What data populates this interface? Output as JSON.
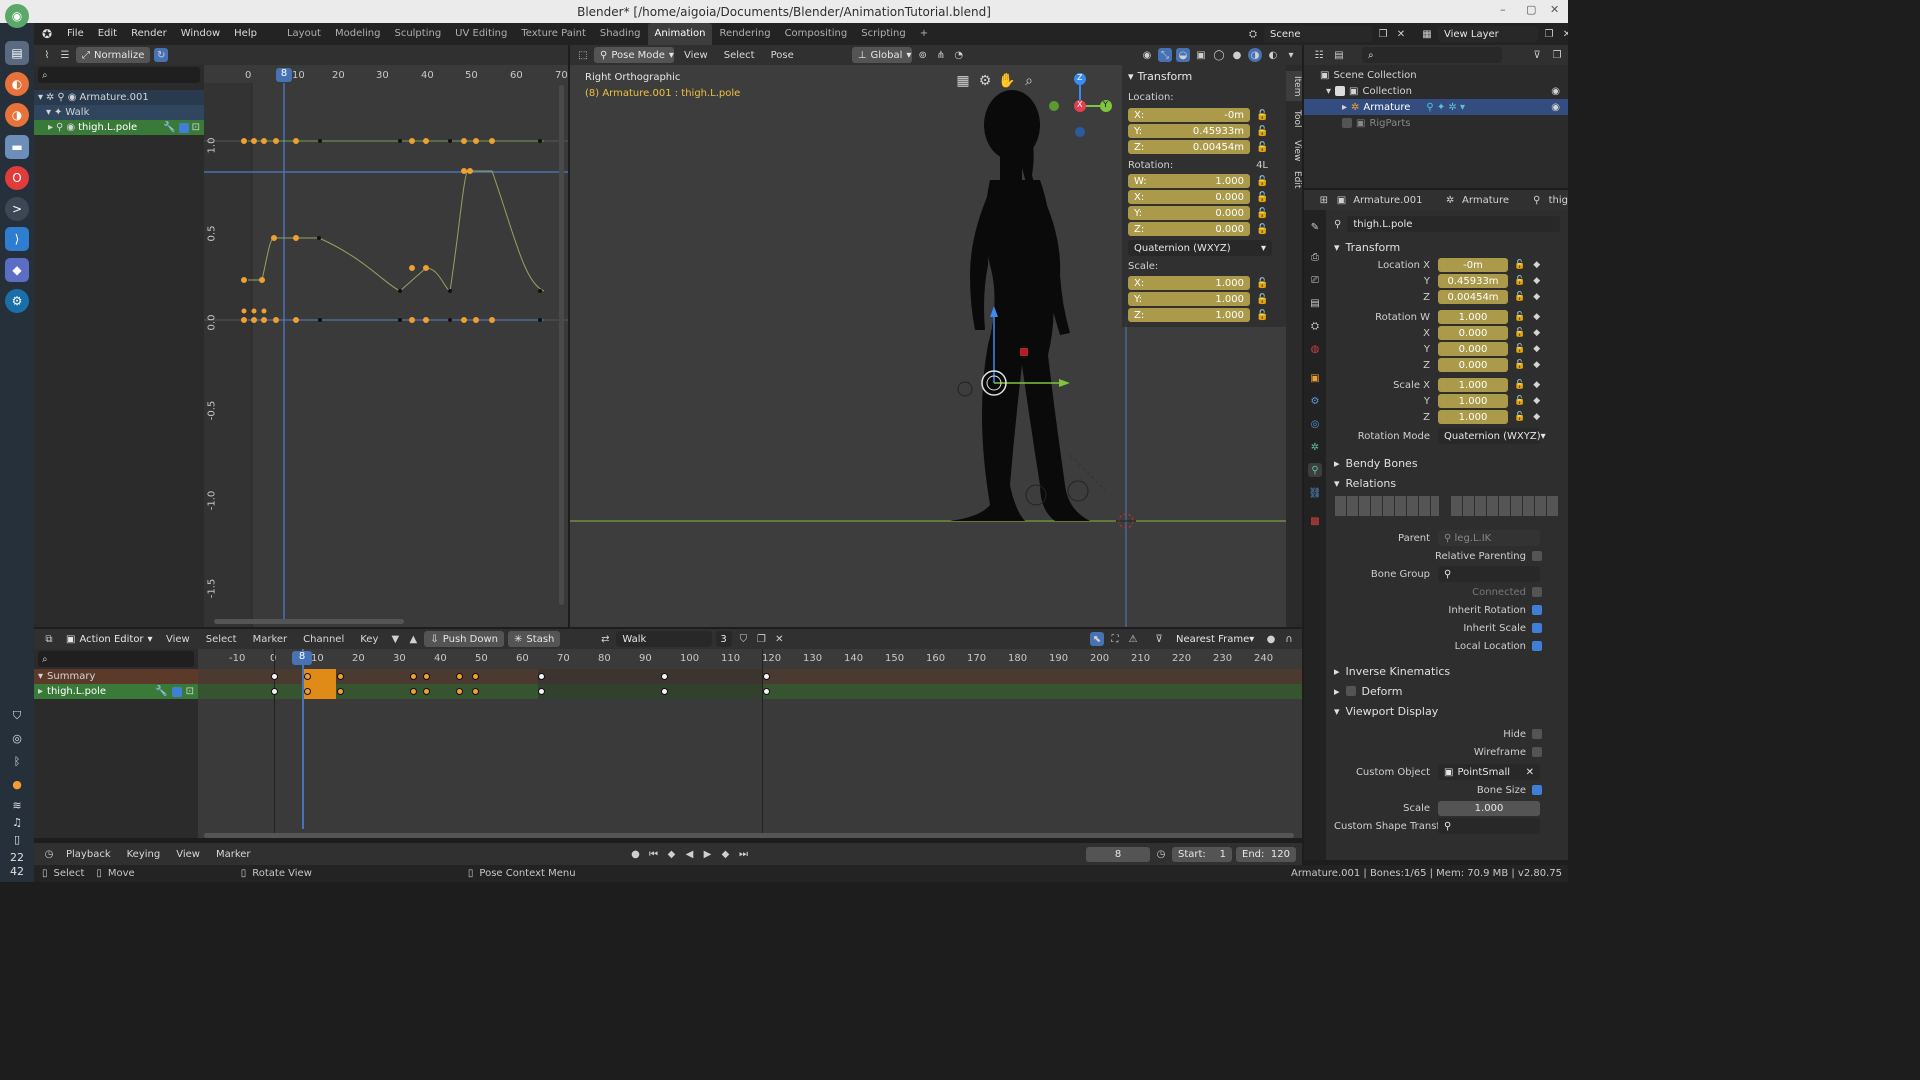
{
  "window": {
    "title": "Blender* [/home/aigoia/Documents/Blender/AnimationTutorial.blend]"
  },
  "dock": {
    "bottom_numbers": [
      "22",
      "42"
    ]
  },
  "menu": {
    "items": [
      "File",
      "Edit",
      "Render",
      "Window",
      "Help"
    ]
  },
  "workspaces": {
    "tabs": [
      "Layout",
      "Modeling",
      "Sculpting",
      "UV Editing",
      "Texture Paint",
      "Shading",
      "Animation",
      "Rendering",
      "Compositing",
      "Scripting"
    ],
    "active": "Animation",
    "add": "+"
  },
  "scene": {
    "name": "Scene",
    "view_layer": "View Layer"
  },
  "graph": {
    "normalize_label": "Normalize",
    "current_frame": "8",
    "x_ticks": [
      "0",
      "10",
      "20",
      "30",
      "40",
      "50",
      "60",
      "70"
    ],
    "y_ticks": [
      "1.0",
      "0.5",
      "0.0",
      "-0.5",
      "-1.0",
      "-1.5"
    ],
    "channels": [
      {
        "label": "Armature.001"
      },
      {
        "label": "Walk"
      },
      {
        "label": "thigh.L.pole"
      }
    ]
  },
  "viewport": {
    "mode": "Pose Mode",
    "menus": [
      "View",
      "Select",
      "Pose"
    ],
    "orientation": "Global",
    "view_name": "Right Orthographic",
    "object_info": "(8) Armature.001 : thigh.L.pole",
    "side_tabs": [
      "Item",
      "Tool",
      "View",
      "Edit"
    ],
    "gizmo": {
      "x": "X",
      "y": "Y",
      "z": "Z"
    },
    "n_panel": {
      "header": "Transform",
      "location_label": "Location:",
      "location": [
        {
          "axis": "X:",
          "value": "-0m"
        },
        {
          "axis": "Y:",
          "value": "0.45933m"
        },
        {
          "axis": "Z:",
          "value": "0.00454m"
        }
      ],
      "rotation_label": "Rotation:",
      "rotation_mode_tag": "4L",
      "rotation": [
        {
          "axis": "W:",
          "value": "1.000"
        },
        {
          "axis": "X:",
          "value": "0.000"
        },
        {
          "axis": "Y:",
          "value": "0.000"
        },
        {
          "axis": "Z:",
          "value": "0.000"
        }
      ],
      "rotation_mode": "Quaternion (WXYZ)",
      "scale_label": "Scale:",
      "scale": [
        {
          "axis": "X:",
          "value": "1.000"
        },
        {
          "axis": "Y:",
          "value": "1.000"
        },
        {
          "axis": "Z:",
          "value": "1.000"
        }
      ]
    }
  },
  "outliner": {
    "items": [
      {
        "label": "Scene Collection"
      },
      {
        "label": "Collection"
      },
      {
        "label": "Armature"
      },
      {
        "label": "RigParts"
      }
    ]
  },
  "properties": {
    "breadcrumb": [
      "Armature.001",
      "Armature",
      "thig"
    ],
    "bone_name": "thigh.L.pole",
    "transform_header": "Transform",
    "rows": [
      {
        "label": "Location X",
        "value": "-0m"
      },
      {
        "label": "Y",
        "value": "0.45933m"
      },
      {
        "label": "Z",
        "value": "0.00454m"
      },
      {
        "label": "Rotation W",
        "value": "1.000"
      },
      {
        "label": "X",
        "value": "0.000"
      },
      {
        "label": "Y",
        "value": "0.000"
      },
      {
        "label": "Z",
        "value": "0.000"
      },
      {
        "label": "Scale X",
        "value": "1.000"
      },
      {
        "label": "Y",
        "value": "1.000"
      },
      {
        "label": "Z",
        "value": "1.000"
      }
    ],
    "rotation_mode_label": "Rotation Mode",
    "rotation_mode": "Quaternion (WXYZ)",
    "bendy_bones": "Bendy Bones",
    "relations": "Relations",
    "parent_label": "Parent",
    "parent_value": "leg.L.IK",
    "relative_parenting": "Relative Parenting",
    "bone_group": "Bone Group",
    "connected": "Connected",
    "inherit_rotation": "Inherit Rotation",
    "inherit_scale": "Inherit Scale",
    "local_location": "Local Location",
    "inverse_kinematics": "Inverse Kinematics",
    "deform": "Deform",
    "viewport_display": "Viewport Display",
    "hide": "Hide",
    "wireframe": "Wireframe",
    "custom_object_label": "Custom Object",
    "custom_object_value": "PointSmall",
    "bone_size": "Bone Size",
    "scale_label": "Scale",
    "scale_value": "1.000",
    "custom_shape_transform": "Custom Shape Transfor.."
  },
  "action_editor": {
    "editor_type": "Action Editor",
    "menus": [
      "View",
      "Select",
      "Marker",
      "Channel",
      "Key"
    ],
    "push_down": "Push Down",
    "stash": "Stash",
    "action_name": "Walk",
    "users": "3",
    "snap": "Nearest Frame",
    "current_frame": "8",
    "ticks": [
      "-10",
      "0",
      "10",
      "20",
      "30",
      "40",
      "50",
      "60",
      "70",
      "80",
      "90",
      "100",
      "110",
      "120",
      "130",
      "140",
      "150",
      "160",
      "170",
      "180",
      "190",
      "200",
      "210",
      "220",
      "230",
      "240"
    ],
    "channels": [
      {
        "label": "Summary"
      },
      {
        "label": "thigh.L.pole"
      }
    ]
  },
  "timeline": {
    "menus": [
      "Playback",
      "Keying",
      "View",
      "Marker"
    ],
    "frame": "8",
    "start_label": "Start:",
    "start": "1",
    "end_label": "End:",
    "end": "120"
  },
  "statusbar": {
    "select": "Select",
    "move": "Move",
    "rotate_view": "Rotate View",
    "context_menu": "Pose Context Menu",
    "info": "Armature.001 | Bones:1/65 | Mem: 70.9 MB | v2.80.75"
  },
  "colors": {
    "accent": "#4772b3",
    "keyframe": "#f0a030",
    "selected_row": "#3a7a38"
  }
}
